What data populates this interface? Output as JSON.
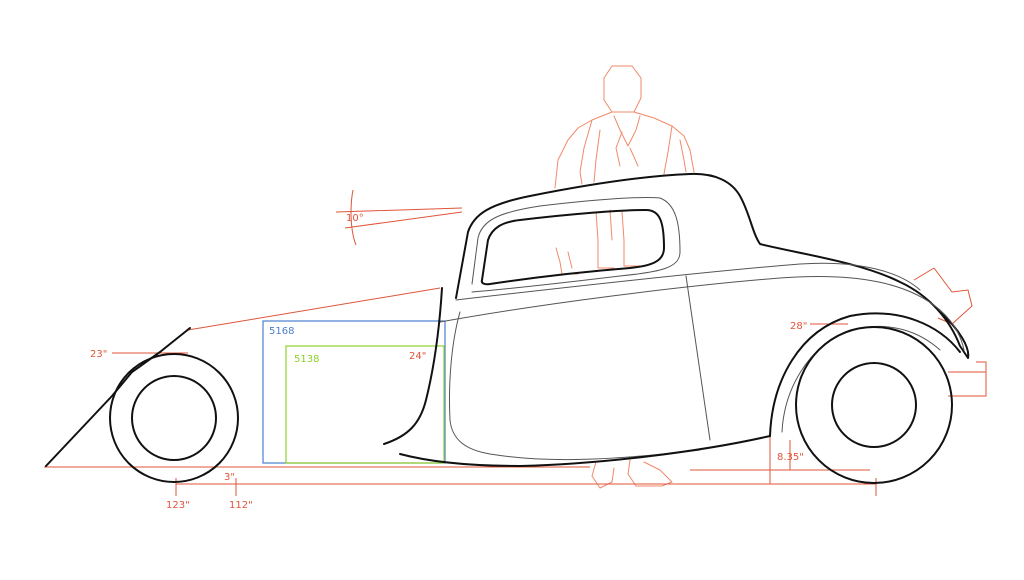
{
  "colors": {
    "car_outline": "#111111",
    "dimension": "#e0553a",
    "figure": "#f08a6a",
    "box_blue": "#4a7fd0",
    "box_green": "#8fd12a"
  },
  "labels": {
    "rake_angle": "10°",
    "front_height": "23\"",
    "rear_height": "28\"",
    "cockpit_depth": "24\"",
    "box_outer": "5168",
    "box_inner": "5138",
    "ground_clearance": "3\"",
    "rear_clearance": "8.35\"",
    "overall_length": "123\"",
    "wheelbase": "112\""
  }
}
